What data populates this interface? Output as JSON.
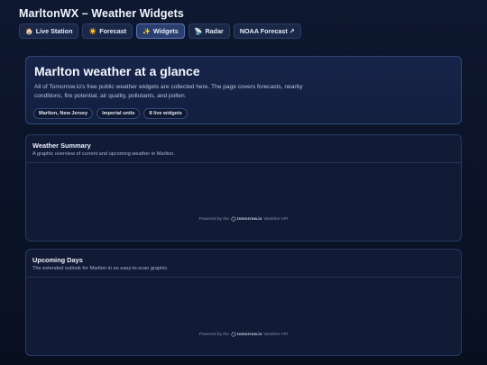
{
  "app": {
    "title": "MarltonWX – Weather Widgets"
  },
  "nav": {
    "tabs": [
      {
        "icon": "🏠",
        "label": "Live Station"
      },
      {
        "icon": "☀️",
        "label": "Forecast"
      },
      {
        "icon": "✨",
        "label": "Widgets",
        "active": true
      },
      {
        "icon": "📡",
        "label": "Radar"
      },
      {
        "icon": "",
        "label": "NOAA Forecast ↗"
      }
    ]
  },
  "hero": {
    "title": "Marlton weather at a glance",
    "description": "All of Tomorrow.io's free public weather widgets are collected here. The page covers forecasts, nearby conditions, fire potential, air quality, pollutants, and pollen.",
    "chips": [
      "Marlton, New Jersey",
      "Imperial units",
      "8 live widgets"
    ]
  },
  "widgets": [
    {
      "title": "Weather Summary",
      "subtitle": "A graphic overview of current and upcoming weather in Marlton.",
      "powered_prefix": "Powered by the",
      "brand": "tomorrow.io",
      "powered_suffix": "Weather API"
    },
    {
      "title": "Upcoming Days",
      "subtitle": "The extended outlook for Marlton in an easy-to-scan graphic.",
      "powered_prefix": "Powered by the",
      "brand": "tomorrow.io",
      "powered_suffix": "Weather API"
    }
  ]
}
